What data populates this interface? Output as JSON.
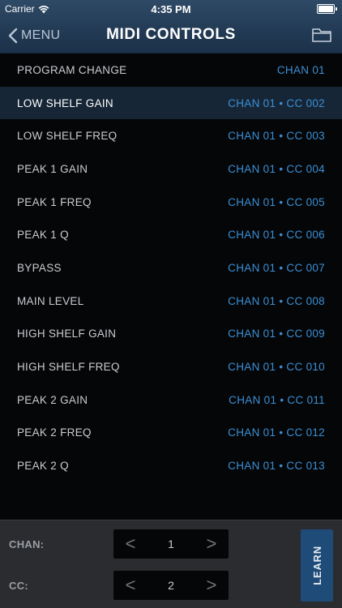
{
  "status": {
    "carrier": "Carrier",
    "time": "4:35 PM"
  },
  "nav": {
    "back_label": "MENU",
    "title": "MIDI CONTROLS"
  },
  "rows": [
    {
      "label": "PROGRAM CHANGE",
      "value": "CHAN 01"
    },
    {
      "label": "LOW SHELF GAIN",
      "value": "CHAN 01 • CC 002",
      "selected": true
    },
    {
      "label": "LOW SHELF FREQ",
      "value": "CHAN 01 • CC 003"
    },
    {
      "label": "PEAK 1 GAIN",
      "value": "CHAN 01 • CC 004"
    },
    {
      "label": "PEAK 1 FREQ",
      "value": "CHAN 01 • CC 005"
    },
    {
      "label": "PEAK 1 Q",
      "value": "CHAN 01 • CC 006"
    },
    {
      "label": "BYPASS",
      "value": "CHAN 01 • CC 007"
    },
    {
      "label": "MAIN LEVEL",
      "value": "CHAN 01 • CC 008"
    },
    {
      "label": "HIGH SHELF GAIN",
      "value": "CHAN 01 • CC 009"
    },
    {
      "label": "HIGH SHELF FREQ",
      "value": "CHAN 01 • CC 010"
    },
    {
      "label": "PEAK 2 GAIN",
      "value": "CHAN 01 • CC 011"
    },
    {
      "label": "PEAK 2 FREQ",
      "value": "CHAN 01 • CC 012"
    },
    {
      "label": "PEAK 2 Q",
      "value": "CHAN 01 • CC 013"
    }
  ],
  "panel": {
    "chan_label": "CHAN:",
    "chan_value": "1",
    "cc_label": "CC:",
    "cc_value": "2",
    "prev_glyph": "<",
    "next_glyph": ">",
    "learn_label": "LEARN"
  },
  "colors": {
    "accent": "#3c8fd6",
    "selected_row": "#162636",
    "learn_button": "#1e4b77"
  }
}
